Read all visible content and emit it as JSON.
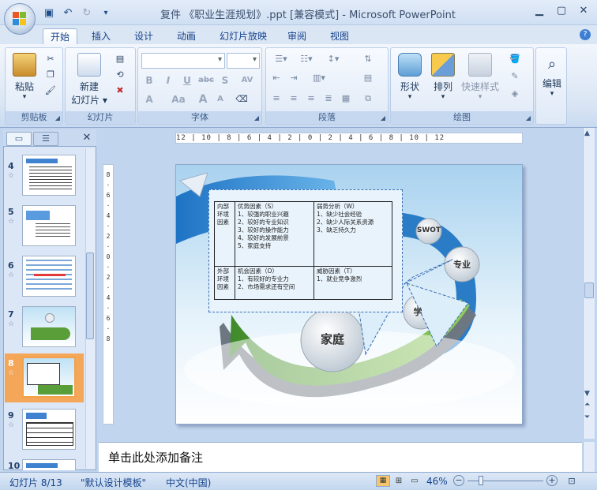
{
  "window": {
    "title": "复件 《职业生涯规划》.ppt [兼容模式] - Microsoft PowerPoint",
    "help_glyph": "?"
  },
  "tabs": [
    {
      "label": "开始",
      "active": true
    },
    {
      "label": "插入"
    },
    {
      "label": "设计"
    },
    {
      "label": "动画"
    },
    {
      "label": "幻灯片放映"
    },
    {
      "label": "审阅"
    },
    {
      "label": "视图"
    }
  ],
  "ribbon": {
    "clipboard": {
      "label": "剪贴板",
      "paste": "粘贴"
    },
    "slides": {
      "label": "幻灯片",
      "new_slide_line1": "新建",
      "new_slide_line2": "幻灯片"
    },
    "font": {
      "label": "字体",
      "bold": "B",
      "italic": "I",
      "underline": "U",
      "strike": "abc",
      "shadow": "S",
      "spacing": "AV",
      "color_a": "A",
      "case": "Aa",
      "grow": "A",
      "shrink": "A"
    },
    "paragraph": {
      "label": "段落"
    },
    "drawing": {
      "label": "绘图",
      "shapes": "形状",
      "arrange": "排列",
      "quick_styles": "快速样式"
    },
    "editing": {
      "label": "编辑"
    }
  },
  "thumbnails": [
    {
      "num": "4"
    },
    {
      "num": "5"
    },
    {
      "num": "6"
    },
    {
      "num": "7"
    },
    {
      "num": "8",
      "selected": true
    },
    {
      "num": "9"
    },
    {
      "num": "10"
    }
  ],
  "rulers": {
    "horizontal": "12 | 10 | 8 | 6 | 4 | 2 | 0 | 2 | 4 | 6 | 8 | 10 | 12"
  },
  "slide": {
    "swot_label": "SWOT",
    "zhuanye": "专业",
    "xue": "学",
    "jiating": "家庭",
    "table": {
      "internal": "内部环境因素",
      "external": "外部环境因素",
      "s_head": "优势因素（S）",
      "w_head": "弱势分析（W）",
      "o_head": "机会因素（O）",
      "t_head": "威胁因素（T）",
      "s_items": [
        "1、较强的职业兴趣",
        "2、较好的专业知识",
        "3、较好的操作能力",
        "4、较好的发展前景",
        "5、家庭支持"
      ],
      "w_items": [
        "1、缺少社会经验",
        "2、缺少人际关系资源",
        "3、缺乏持久力"
      ],
      "o_items": [
        "1、有较好的专业力",
        "2、市场需求还有空间"
      ],
      "t_items": [
        "1、就业竞争激烈"
      ]
    }
  },
  "notes": {
    "placeholder": "单击此处添加备注"
  },
  "status": {
    "slide": "幻灯片 8/13",
    "theme": "\"默认设计模板\"",
    "lang": "中文(中国)",
    "zoom": "46%"
  },
  "colors": {
    "accent": "#15428b",
    "selected_thumb": "#f4a659",
    "ribbon_bg": "#dbe6f4"
  }
}
